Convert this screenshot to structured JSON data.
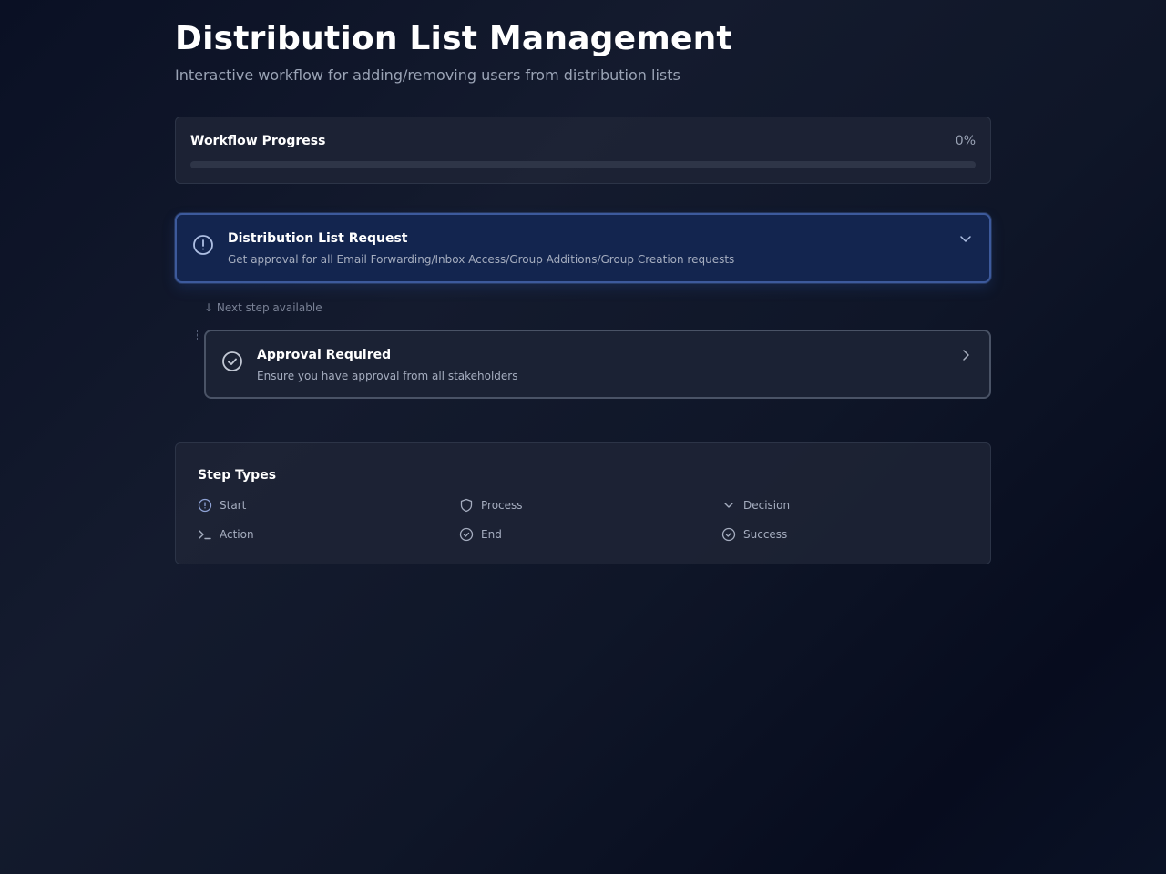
{
  "header": {
    "title": "Distribution List Management",
    "subtitle": "Interactive workflow for adding/removing users from distribution lists"
  },
  "progress": {
    "label": "Workflow Progress",
    "value_text": "0%",
    "fraction": 0
  },
  "steps": [
    {
      "title": "Distribution List Request",
      "description": "Get approval for all Email Forwarding/Inbox Access/Group Additions/Group Creation requests",
      "icon": "alert-circle-icon",
      "state": "active",
      "expanded": true
    },
    {
      "title": "Approval Required",
      "description": "Ensure you have approval from all stakeholders",
      "icon": "check-circle-icon",
      "state": "next",
      "expanded": false
    }
  ],
  "next_hint": "↓ Next step available",
  "legend": {
    "title": "Step Types",
    "items": [
      {
        "label": "Start",
        "icon": "alert-circle-icon"
      },
      {
        "label": "Process",
        "icon": "shield-icon"
      },
      {
        "label": "Decision",
        "icon": "chevron-down-icon"
      },
      {
        "label": "Action",
        "icon": "terminal-icon"
      },
      {
        "label": "End",
        "icon": "check-circle-icon"
      },
      {
        "label": "Success",
        "icon": "check-circle-icon"
      }
    ]
  },
  "colors": {
    "background": "#0a1024",
    "card": "#1e2436",
    "active_card": "#13254f",
    "active_border": "#3d5a9c",
    "accent": "#3b82f6"
  }
}
